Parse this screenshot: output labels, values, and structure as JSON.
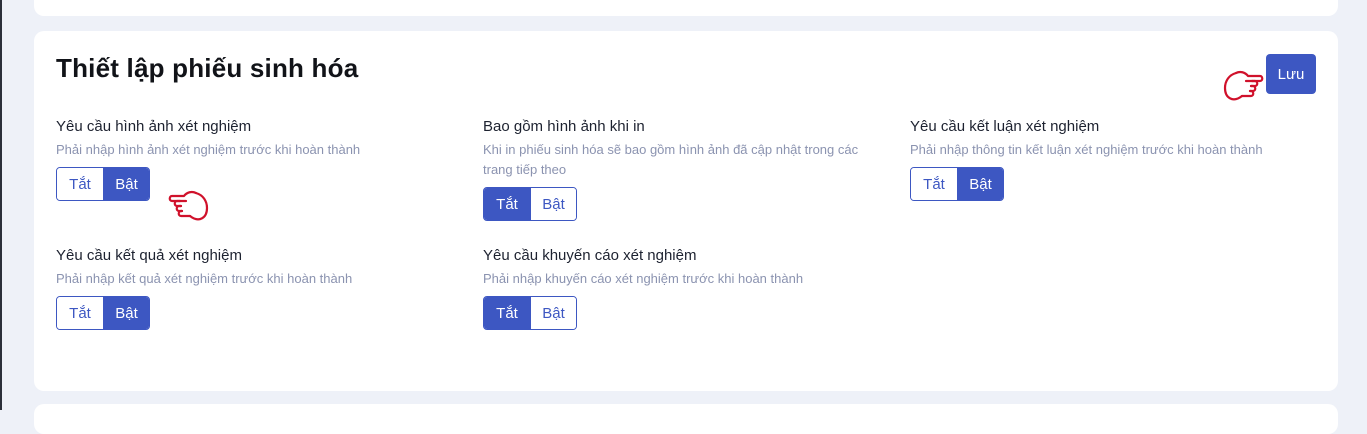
{
  "panel": {
    "title": "Thiết lập phiếu sinh hóa",
    "save_label": "Lưu"
  },
  "settings": [
    {
      "label": "Yêu cầu hình ảnh xét nghiệm",
      "description": "Phải nhập hình ảnh xét nghiệm trước khi hoàn thành",
      "off_label": "Tắt",
      "on_label": "Bật",
      "selected": "on"
    },
    {
      "label": "Bao gồm hình ảnh khi in",
      "description": "Khi in phiếu sinh hóa sẽ bao gồm hình ảnh đã cập nhật trong các trang tiếp theo",
      "off_label": "Tắt",
      "on_label": "Bật",
      "selected": "off"
    },
    {
      "label": "Yêu cầu kết luận xét nghiệm",
      "description": "Phải nhập thông tin kết luận xét nghiệm trước khi hoàn thành",
      "off_label": "Tắt",
      "on_label": "Bật",
      "selected": "on"
    },
    {
      "label": "Yêu cầu kết quả xét nghiệm",
      "description": "Phải nhập kết quả xét nghiệm trước khi hoàn thành",
      "off_label": "Tắt",
      "on_label": "Bật",
      "selected": "on"
    },
    {
      "label": "Yêu cầu khuyến cáo xét nghiệm",
      "description": "Phải nhập khuyến cáo xét nghiệm trước khi hoàn thành",
      "off_label": "Tắt",
      "on_label": "Bật",
      "selected": "off"
    }
  ],
  "colors": {
    "accent": "#3d57c2",
    "pointer": "#d0112b",
    "background": "#eef1f8"
  },
  "icons": [
    "pointing-hand-icon"
  ]
}
